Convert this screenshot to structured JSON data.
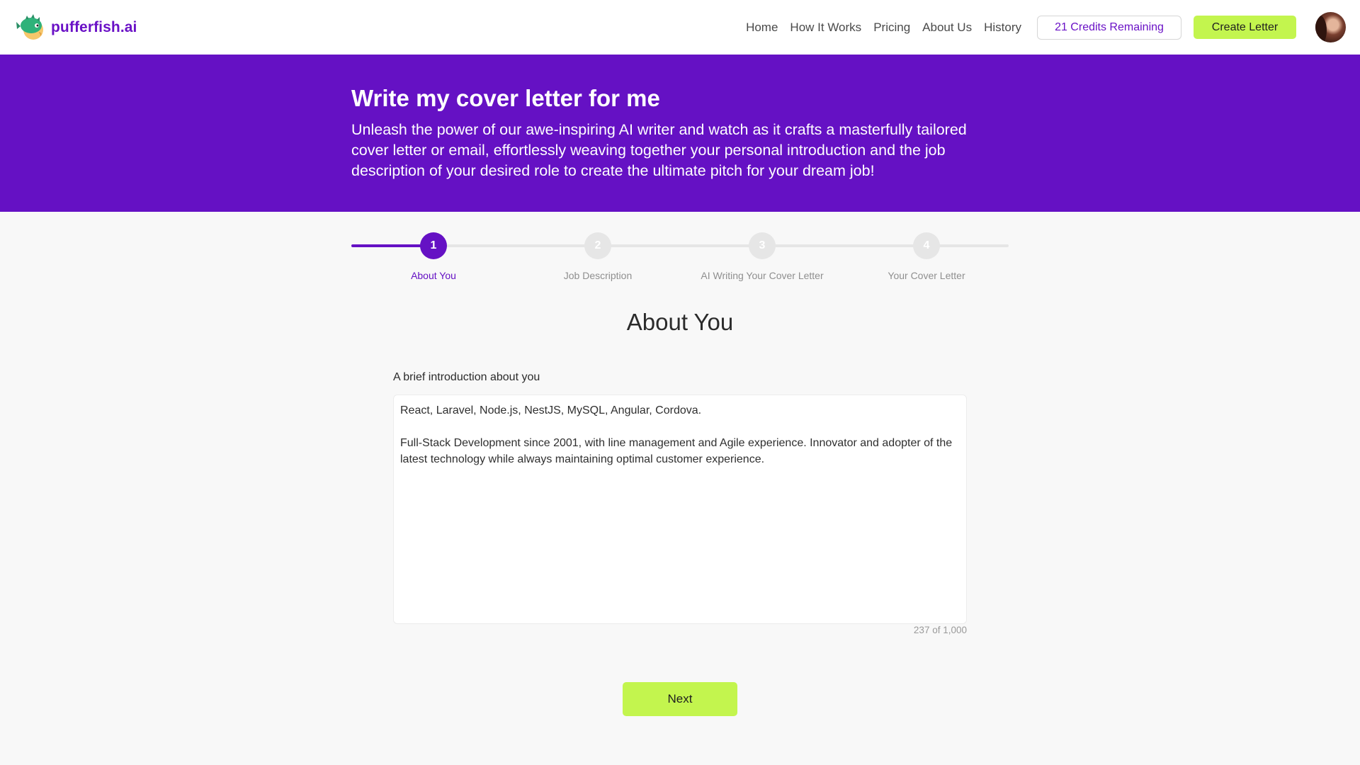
{
  "brand": {
    "name": "pufferfish.ai",
    "logo_icon": "pufferfish-logo-icon"
  },
  "nav": {
    "links": [
      "Home",
      "How It Works",
      "Pricing",
      "About Us",
      "History"
    ],
    "credits_label": "21 Credits Remaining",
    "create_label": "Create Letter",
    "avatar_icon": "user-avatar"
  },
  "hero": {
    "title": "Write my cover letter for me",
    "subtitle": "Unleash the power of our awe-inspiring AI writer and watch as it crafts a masterfully tailored cover letter or email, effortlessly weaving together your personal introduction and the job description of your desired role to create the ultimate pitch for your dream job!"
  },
  "stepper": {
    "current_step": 1,
    "steps": [
      {
        "number": "1",
        "label": "About You"
      },
      {
        "number": "2",
        "label": "Job Description"
      },
      {
        "number": "3",
        "label": "AI Writing Your Cover Letter"
      },
      {
        "number": "4",
        "label": "Your Cover Letter"
      }
    ]
  },
  "form": {
    "title": "About You",
    "field_label": "A brief introduction about you",
    "intro_value": "React, Laravel, Node.js, NestJS, MySQL, Angular, Cordova.\n\nFull-Stack Development since 2001, with line management and Agile experience. Innovator and adopter of the latest technology while always maintaining optimal customer experience.",
    "char_counter": "237 of 1,000",
    "next_label": "Next"
  },
  "colors": {
    "brand_purple": "#6511c4",
    "accent_lime": "#c3f54e",
    "page_bg": "#f8f8f8"
  }
}
